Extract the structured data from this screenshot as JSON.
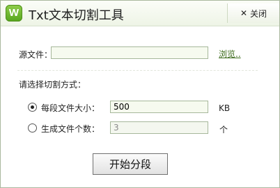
{
  "window": {
    "icon_letter": "W",
    "title": "Txt文本切割工具",
    "close_label": "关闭"
  },
  "form": {
    "source_label": "源文件：",
    "source_value": "",
    "browse_label": "浏览..",
    "mode_prompt": "请选择切割方式：",
    "options": [
      {
        "label": "每段文件大小：",
        "value": "500",
        "unit": "KB",
        "selected": true
      },
      {
        "label": "生成文件个数：",
        "value": "3",
        "unit": "个",
        "selected": false
      }
    ],
    "start_label": "开始分段"
  }
}
